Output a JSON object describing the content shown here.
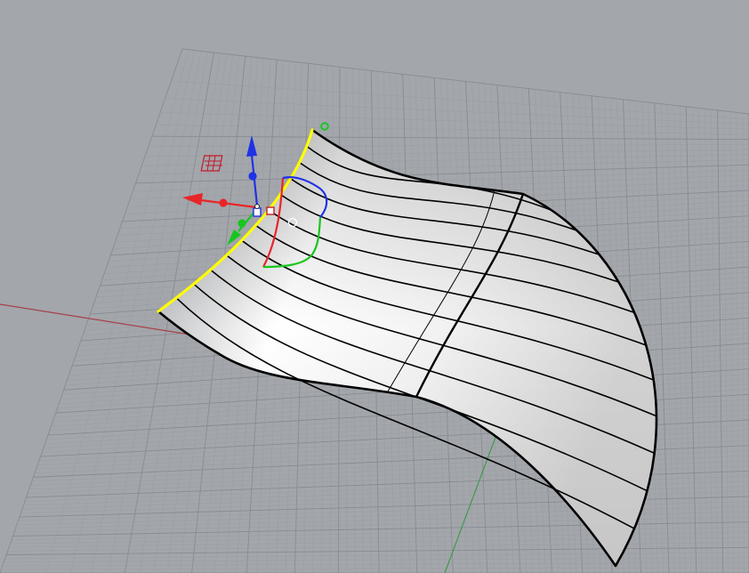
{
  "viewport": {
    "name": "",
    "projection": "perspective",
    "display_mode": "rendered",
    "grid_visible": true,
    "world_axes_visible": true
  },
  "colors": {
    "background": "#a3a6ab",
    "grid_minor": "#999da2",
    "grid_major": "#888c92",
    "x_axis": "#a6424a",
    "y_axis": "#3f9a4a",
    "surface_curves": "#000000",
    "selected_edge": "#ffff00",
    "gumball_x": "#e8262a",
    "gumball_y": "#17c61f",
    "gumball_z": "#1f32e6"
  },
  "scene": {
    "surface": {
      "type": "lofted-surface",
      "isocurve_count": 11
    },
    "selected_edge": {
      "type": "surface-edge",
      "state": "selected"
    },
    "gumball": {
      "visible": true,
      "handles": [
        "move-x",
        "move-y",
        "move-z",
        "rotate-x",
        "rotate-y",
        "rotate-z",
        "scale-x",
        "scale-y",
        "menu",
        "drag-strip"
      ]
    }
  }
}
